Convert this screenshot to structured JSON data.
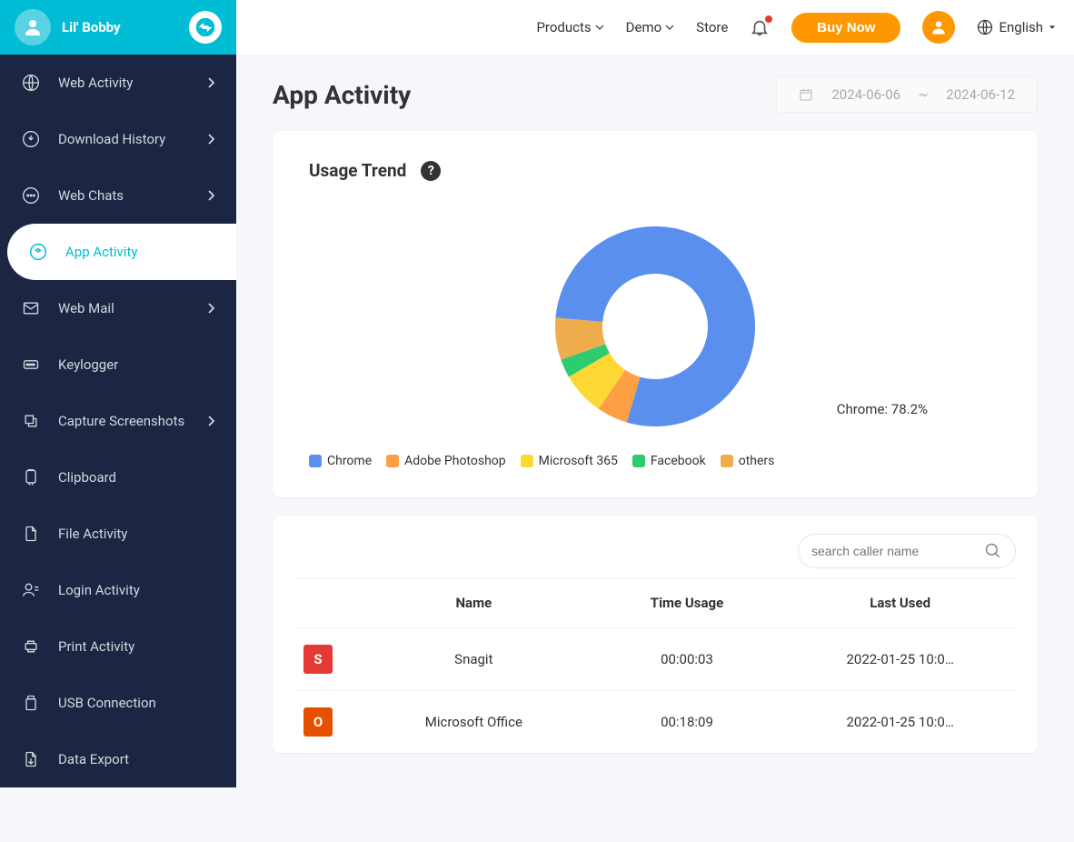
{
  "header": {
    "username": "Lil' Bobby",
    "nav": {
      "products": "Products",
      "demo": "Demo",
      "store": "Store"
    },
    "buy": "Buy Now",
    "language": "English"
  },
  "sidebar": {
    "items": [
      {
        "label": "Web Activity",
        "expandable": true
      },
      {
        "label": "Download History",
        "expandable": true
      },
      {
        "label": "Web Chats",
        "expandable": true
      },
      {
        "label": "App Activity",
        "expandable": false,
        "active": true
      },
      {
        "label": "Web Mail",
        "expandable": true
      },
      {
        "label": "Keylogger",
        "expandable": false
      },
      {
        "label": "Capture Screenshots",
        "expandable": true
      },
      {
        "label": "Clipboard",
        "expandable": false
      },
      {
        "label": "File Activity",
        "expandable": false
      },
      {
        "label": "Login Activity",
        "expandable": false
      },
      {
        "label": "Print Activity",
        "expandable": false
      },
      {
        "label": "USB Connection",
        "expandable": false
      },
      {
        "label": "Data Export",
        "expandable": false
      }
    ]
  },
  "page": {
    "title": "App Activity",
    "date_from": "2024-06-06",
    "date_sep": "~",
    "date_to": "2024-06-12"
  },
  "usage": {
    "title": "Usage Trend",
    "callout": "Chrome: 78.2%"
  },
  "chart_data": {
    "type": "pie",
    "title": "Usage Trend",
    "categories": [
      "Chrome",
      "Adobe Photoshop",
      "Microsoft 365",
      "Facebook",
      "others"
    ],
    "values": [
      78.2,
      5.0,
      7.0,
      3.0,
      6.8
    ],
    "colors": [
      "#5a8fee",
      "#ff9f43",
      "#fdd835",
      "#2ecc71",
      "#f0ad4e"
    ]
  },
  "table": {
    "search_placeholder": "search caller name",
    "columns": {
      "name": "Name",
      "time": "Time Usage",
      "last": "Last Used"
    },
    "rows": [
      {
        "icon_bg": "#e53935",
        "icon_text": "S",
        "name": "Snagit",
        "time": "00:00:03",
        "last": "2022-01-25 10:0…"
      },
      {
        "icon_bg": "#e65100",
        "icon_text": "O",
        "name": "Microsoft Office",
        "time": "00:18:09",
        "last": "2022-01-25 10:0…"
      }
    ]
  }
}
